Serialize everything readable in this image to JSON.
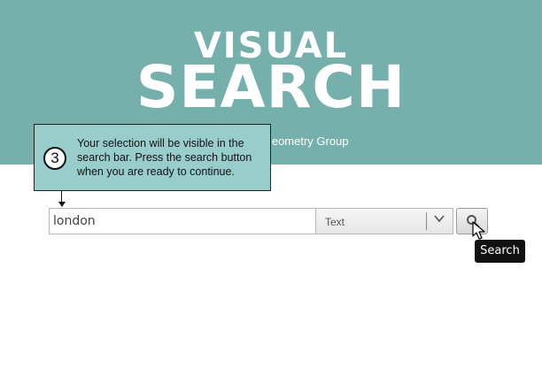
{
  "header": {
    "logo_line1": "VISUAL",
    "logo_line2": "SEARCH",
    "subtitle": "al Geometry Group",
    "background_color": "#75b0ac"
  },
  "callout": {
    "step_number": "3",
    "text": "Your selection will be visible in the search bar. Press the search button when you are ready to continue.",
    "background_color": "#99cdcc"
  },
  "search": {
    "query_value": "london",
    "type_selected": "Text",
    "dropdown_icon": "chevron-down-icon",
    "button_icon": "search-icon",
    "tooltip": "Search"
  },
  "cursor": {
    "icon": "mouse-pointer-icon"
  }
}
